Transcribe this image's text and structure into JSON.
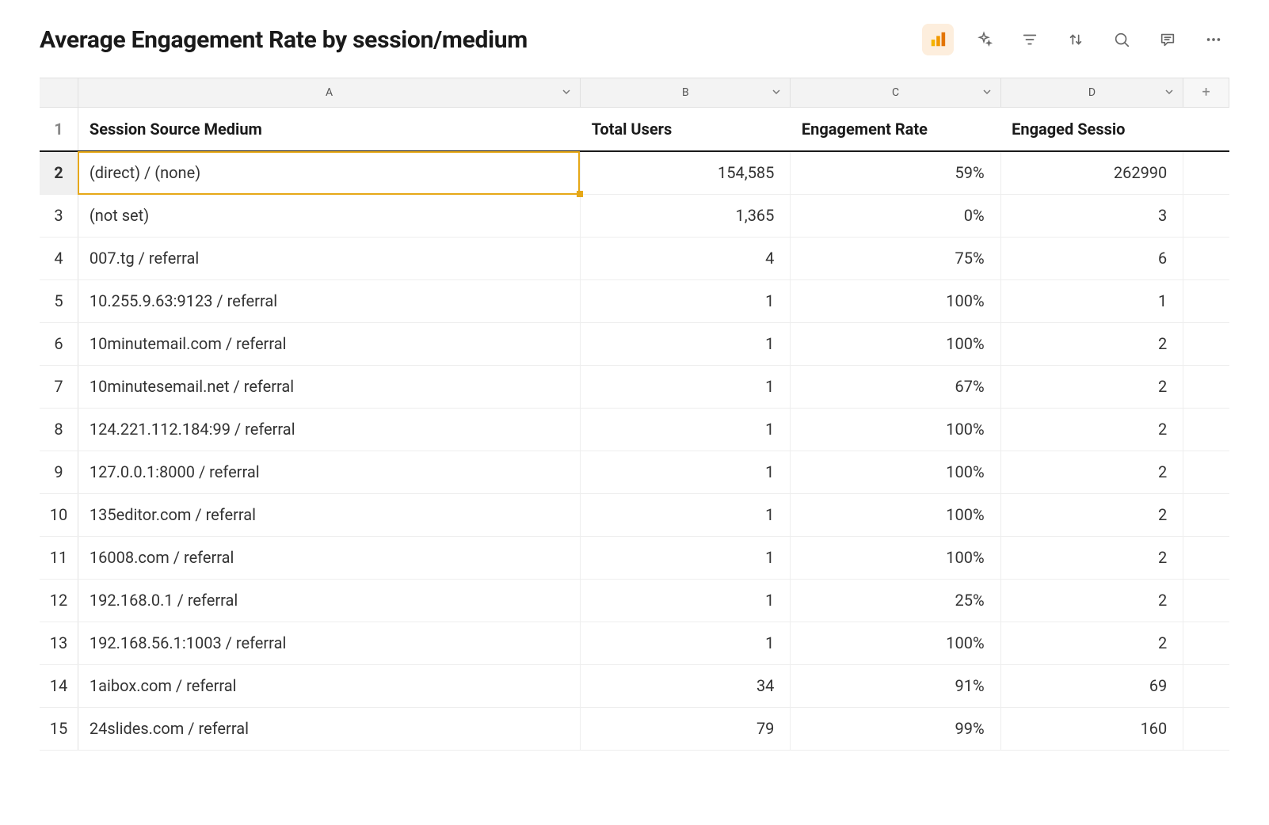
{
  "title": "Average Engagement Rate by session/medium",
  "columns": {
    "letters": [
      "A",
      "B",
      "C",
      "D"
    ],
    "headers": {
      "A": "Session Source Medium",
      "B": "Total Users",
      "C": "Engagement Rate",
      "D": "Engaged Sessio"
    }
  },
  "selected": {
    "row": 2,
    "col": "A"
  },
  "rows": [
    {
      "n": 2,
      "A": "(direct) / (none)",
      "B": "154,585",
      "C": "59%",
      "D": "262990"
    },
    {
      "n": 3,
      "A": "(not set)",
      "B": "1,365",
      "C": "0%",
      "D": "3"
    },
    {
      "n": 4,
      "A": "007.tg / referral",
      "B": "4",
      "C": "75%",
      "D": "6"
    },
    {
      "n": 5,
      "A": "10.255.9.63:9123 / referral",
      "B": "1",
      "C": "100%",
      "D": "1"
    },
    {
      "n": 6,
      "A": "10minutemail.com / referral",
      "B": "1",
      "C": "100%",
      "D": "2"
    },
    {
      "n": 7,
      "A": "10minutesemail.net / referral",
      "B": "1",
      "C": "67%",
      "D": "2"
    },
    {
      "n": 8,
      "A": "124.221.112.184:99 / referral",
      "B": "1",
      "C": "100%",
      "D": "2"
    },
    {
      "n": 9,
      "A": "127.0.0.1:8000 / referral",
      "B": "1",
      "C": "100%",
      "D": "2"
    },
    {
      "n": 10,
      "A": "135editor.com / referral",
      "B": "1",
      "C": "100%",
      "D": "2"
    },
    {
      "n": 11,
      "A": "16008.com / referral",
      "B": "1",
      "C": "100%",
      "D": "2"
    },
    {
      "n": 12,
      "A": "192.168.0.1 / referral",
      "B": "1",
      "C": "25%",
      "D": "2"
    },
    {
      "n": 13,
      "A": "192.168.56.1:1003 / referral",
      "B": "1",
      "C": "100%",
      "D": "2"
    },
    {
      "n": 14,
      "A": "1aibox.com / referral",
      "B": "34",
      "C": "91%",
      "D": "69"
    },
    {
      "n": 15,
      "A": "24slides.com / referral",
      "B": "79",
      "C": "99%",
      "D": "160"
    }
  ],
  "toolbar": {
    "analytics": "analytics",
    "sparkle": "ai-suggest",
    "filter": "filter",
    "sort": "sort",
    "search": "search",
    "comment": "comment",
    "more": "more"
  }
}
